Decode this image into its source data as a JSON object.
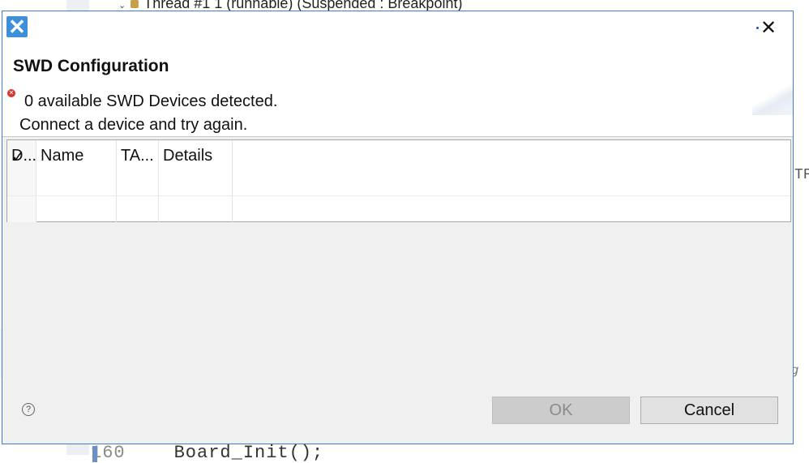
{
  "background": {
    "thread_label": "Thread #1 1 (runnable) (Suspended : Breakpoint)",
    "code_line_number": "160",
    "code_text": "Board_Init();",
    "right_fragment_1": "TF",
    "right_fragment_2": "g"
  },
  "dialog": {
    "title": "SWD Configuration",
    "close_symbol": "✕",
    "message": {
      "line1": "0 available SWD Devices detected.",
      "line2": "Connect a device and try again."
    },
    "table": {
      "columns": [
        "D...",
        "Name",
        "TA...",
        "Details"
      ],
      "rows": []
    },
    "buttons": {
      "help": "?",
      "ok": "OK",
      "cancel": "Cancel"
    }
  },
  "colors": {
    "accent": "#3c7fc7",
    "error": "#d9342b"
  }
}
